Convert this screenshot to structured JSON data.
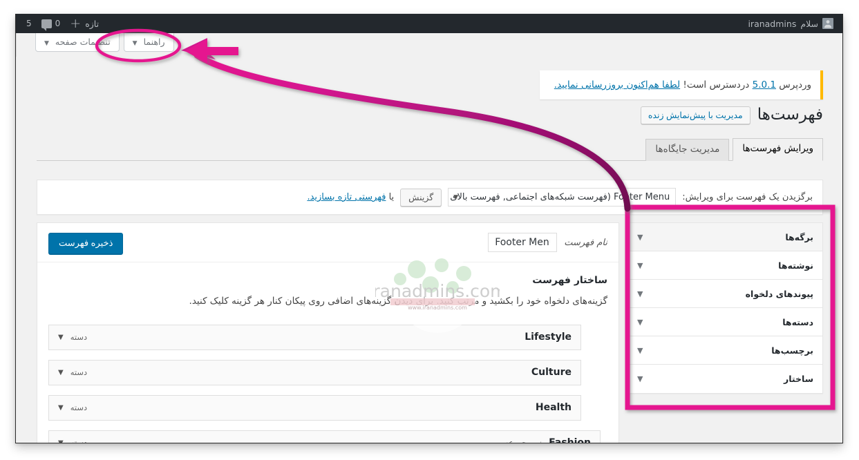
{
  "adminbar": {
    "greeting": "سلام",
    "username": "iranadmins",
    "avatar_icon": "user-avatar-icon",
    "new_label": "تازه",
    "plus_icon": "plus-icon",
    "comments_icon": "comment-bubble-icon",
    "comments_count": "0",
    "updates_count": "5"
  },
  "screen_meta": {
    "screen_options_label": "تنظیمات صفحه",
    "help_label": "راهنما",
    "caret_icon": "chevron-down-icon"
  },
  "update_notice": {
    "text_before": "وردپرس ",
    "version_link": "5.0.1",
    "text_middle": " دردسترس است! ",
    "action_link": "لطفا هم‌اکنون بروزرسانی نمایید."
  },
  "page": {
    "title": "فهرست‌ها",
    "live_preview_button": "مدیریت با پیش‌نمایش زنده"
  },
  "tabs": [
    {
      "label": "ویرایش فهرست‌ها",
      "active": true
    },
    {
      "label": "مدیریت جایگاه‌ها",
      "active": false
    }
  ],
  "chooser": {
    "label": "برگزیدن یک فهرست برای ویرایش:",
    "selected_menu": "Footer Menu (فهرست شبکه‌های اجتماعی, فهرست بالای",
    "select_caret_icon": "chevron-down-icon",
    "select_button": "گزینش",
    "or_text": "یا ",
    "create_link": "فهرستی تازه بسازید."
  },
  "sidebar": {
    "items": [
      {
        "label": "برگه‌ها",
        "caret_icon": "chevron-down-icon",
        "shaded": true
      },
      {
        "label": "نوشته‌ها",
        "caret_icon": "chevron-down-icon",
        "shaded": false
      },
      {
        "label": "پیوندهای دلخواه",
        "caret_icon": "chevron-down-icon",
        "shaded": false
      },
      {
        "label": "دسته‌ها",
        "caret_icon": "chevron-down-icon",
        "shaded": false
      },
      {
        "label": "برچسب‌ها",
        "caret_icon": "chevron-down-icon",
        "shaded": false
      },
      {
        "label": "ساختار",
        "caret_icon": "chevron-down-icon",
        "shaded": false
      }
    ]
  },
  "menu_editor": {
    "name_label": "نام فهرست",
    "name_value": "Footer Menu",
    "save_button": "ذخیره فهرست",
    "structure_title": "ساختار فهرست",
    "structure_help": "گزینه‌های دلخواه خود را بکشید و مرتب کنید. برای دیدن گزینه‌های اضافی روی پیکان کنار هر گزینه کلیک کنید.",
    "items": [
      {
        "title": "Lifestyle",
        "sub_label": "",
        "type": "دسته",
        "depth": 0,
        "caret_icon": "chevron-down-icon"
      },
      {
        "title": "Culture",
        "sub_label": "",
        "type": "دسته",
        "depth": 0,
        "caret_icon": "chevron-down-icon"
      },
      {
        "title": "Health",
        "sub_label": "",
        "type": "دسته",
        "depth": 0,
        "caret_icon": "chevron-down-icon"
      },
      {
        "title": "Fashion",
        "sub_label": "زیرمجموعه",
        "type": "دسته",
        "depth": 1,
        "caret_icon": "chevron-down-icon"
      }
    ]
  },
  "watermark": {
    "text": "iranadmins.com",
    "subtext": "www.iranadmins.com"
  },
  "annotations": {
    "highlight_color": "#e5188f",
    "arrow_color": "#cc1184",
    "ellipse_target": "تنظیمات صفحه",
    "box_target": "sidebar-panel"
  }
}
